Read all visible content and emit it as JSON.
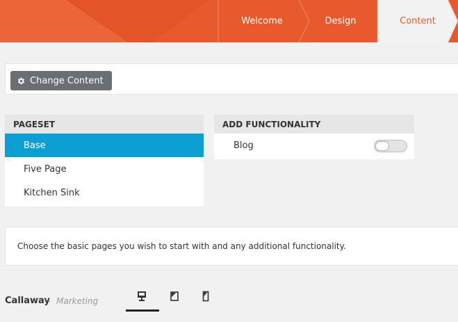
{
  "wizard": {
    "steps": [
      {
        "label": "Welcome"
      },
      {
        "label": "Design"
      },
      {
        "label": "Content"
      }
    ],
    "active_index": 2
  },
  "toolbar": {
    "change_content_label": "Change Content",
    "change_content_icon": "gear-icon"
  },
  "pageset": {
    "heading": "PAGESET",
    "items": [
      {
        "label": "Base",
        "selected": true
      },
      {
        "label": "Five Page",
        "selected": false
      },
      {
        "label": "Kitchen Sink",
        "selected": false
      }
    ]
  },
  "functionality": {
    "heading": "ADD FUNCTIONALITY",
    "items": [
      {
        "label": "Blog",
        "enabled": false
      }
    ]
  },
  "info": {
    "text": "Choose the basic pages you wish to start with and any additional functionality."
  },
  "footer": {
    "theme_name": "Callaway",
    "separator": "-",
    "theme_category": "Marketing",
    "devices": [
      {
        "icon": "desktop-icon",
        "active": true
      },
      {
        "icon": "tablet-icon",
        "active": false
      },
      {
        "icon": "phone-icon",
        "active": false
      }
    ]
  },
  "colors": {
    "brand_orange": "#e85a2e",
    "selected_blue": "#0c9fd4",
    "button_gray": "#6b6e72"
  }
}
